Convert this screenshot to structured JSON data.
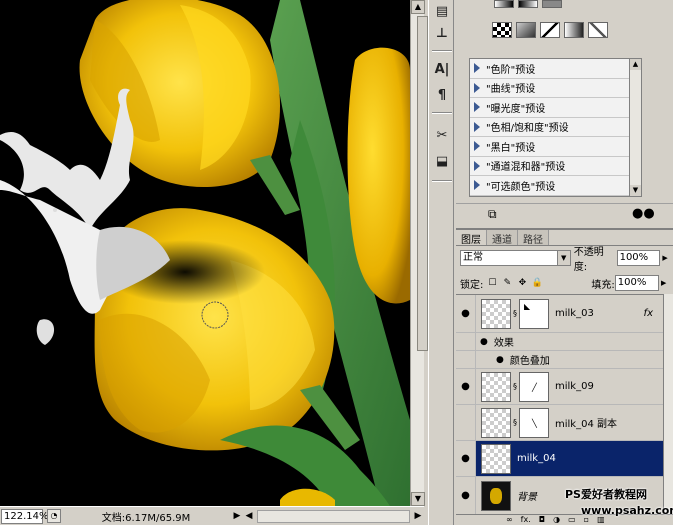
{
  "status": {
    "zoom": "122.14%",
    "doc_info": "文档:6.17M/65.9M"
  },
  "tools": [
    "A|",
    "¶"
  ],
  "presets": [
    "\"色阶\"预设",
    "\"曲线\"预设",
    "\"曝光度\"预设",
    "\"色相/饱和度\"预设",
    "\"黑白\"预设",
    "\"通道混和器\"预设",
    "\"可选颜色\"预设"
  ],
  "layers_panel": {
    "tabs": [
      "图层",
      "通道",
      "路径"
    ],
    "active_tab": 0,
    "blend_mode": "正常",
    "opacity_label": "不透明度:",
    "opacity_value": "100%",
    "lock_label": "锁定:",
    "fill_label": "填充:",
    "fill_value": "100%",
    "layers": [
      {
        "name": "milk_03",
        "fx": "fx",
        "visible": true
      },
      {
        "name": "效果",
        "sub": true
      },
      {
        "name": "颜色叠加",
        "sub": true
      },
      {
        "name": "milk_09",
        "visible": true
      },
      {
        "name": "milk_04 副本",
        "visible": false
      },
      {
        "name": "milk_04",
        "visible": true,
        "selected": true
      },
      {
        "name": "背景",
        "visible": true
      }
    ]
  },
  "watermark": {
    "line1": "PS爱好者教程网",
    "line2": "www.psahz.com"
  },
  "colors": {
    "selection": "#0a246a",
    "panel_bg": "#d4d0c8",
    "tulip_yellow": "#f2c80a"
  }
}
